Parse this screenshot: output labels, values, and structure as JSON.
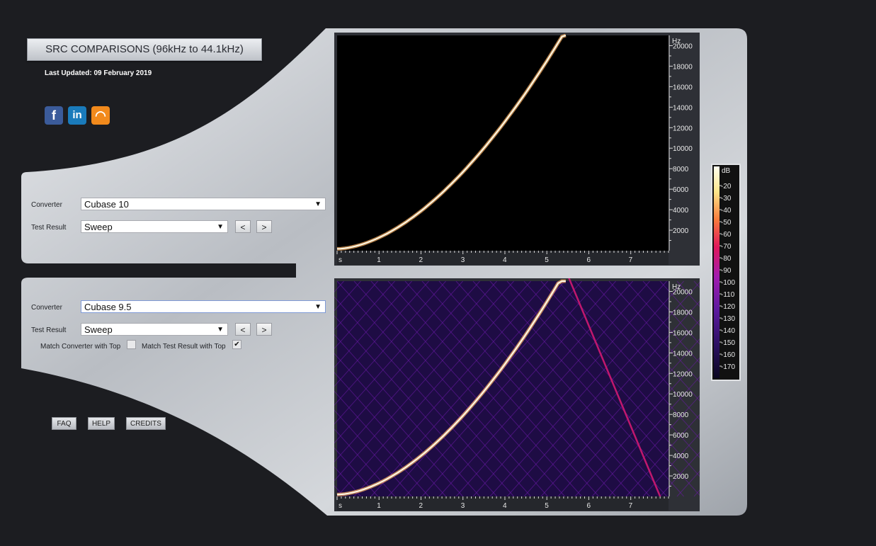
{
  "header": {
    "title": "SRC COMPARISONS (96kHz to 44.1kHz)",
    "last_updated": "Last Updated: 09 February 2019"
  },
  "social": {
    "facebook": "facebook-icon",
    "linkedin": "linkedin-icon",
    "rss": "rss-icon"
  },
  "top_panel": {
    "converter_label": "Converter",
    "converter_value": "Cubase 10",
    "test_label": "Test Result",
    "test_value": "Sweep",
    "prev": "<",
    "next": ">"
  },
  "bottom_panel": {
    "converter_label": "Converter",
    "converter_value": "Cubase 9.5",
    "test_label": "Test Result",
    "test_value": "Sweep",
    "prev": "<",
    "next": ">",
    "match_converter_label": "Match Converter with Top",
    "match_converter_checked": false,
    "match_test_label": "Match Test Result with Top",
    "match_test_checked": true
  },
  "footer_buttons": {
    "faq": "FAQ",
    "help": "HELP",
    "credits": "CREDITS"
  },
  "chart_data": [
    {
      "type": "heatmap",
      "title": "",
      "y_unit": "Hz",
      "x_unit": "s",
      "x_ticks": [
        "1",
        "2",
        "3",
        "4",
        "5",
        "6",
        "7"
      ],
      "y_ticks": [
        "20000",
        "18000",
        "16000",
        "14000",
        "12000",
        "10000",
        "8000",
        "6000",
        "4000",
        "2000"
      ],
      "xlim": [
        0,
        7.9
      ],
      "ylim": [
        0,
        21000
      ],
      "sweep_end_time": 5.45,
      "sweep_end_freq": 21500,
      "aliasing": false
    },
    {
      "type": "heatmap",
      "title": "",
      "y_unit": "Hz",
      "x_unit": "s",
      "x_ticks": [
        "1",
        "2",
        "3",
        "4",
        "5",
        "6",
        "7"
      ],
      "y_ticks": [
        "20000",
        "18000",
        "16000",
        "14000",
        "12000",
        "10000",
        "8000",
        "6000",
        "4000",
        "2000"
      ],
      "xlim": [
        0,
        7.9
      ],
      "ylim": [
        0,
        21000
      ],
      "sweep_end_time": 5.45,
      "sweep_end_freq": 22050,
      "aliasing": true
    }
  ],
  "colorbar": {
    "unit": "dB",
    "labels": [
      "-20",
      "-30",
      "-40",
      "-50",
      "-60",
      "-70",
      "-80",
      "-90",
      "-100",
      "-110",
      "-120",
      "-130",
      "-140",
      "-150",
      "-160",
      "-170"
    ]
  }
}
